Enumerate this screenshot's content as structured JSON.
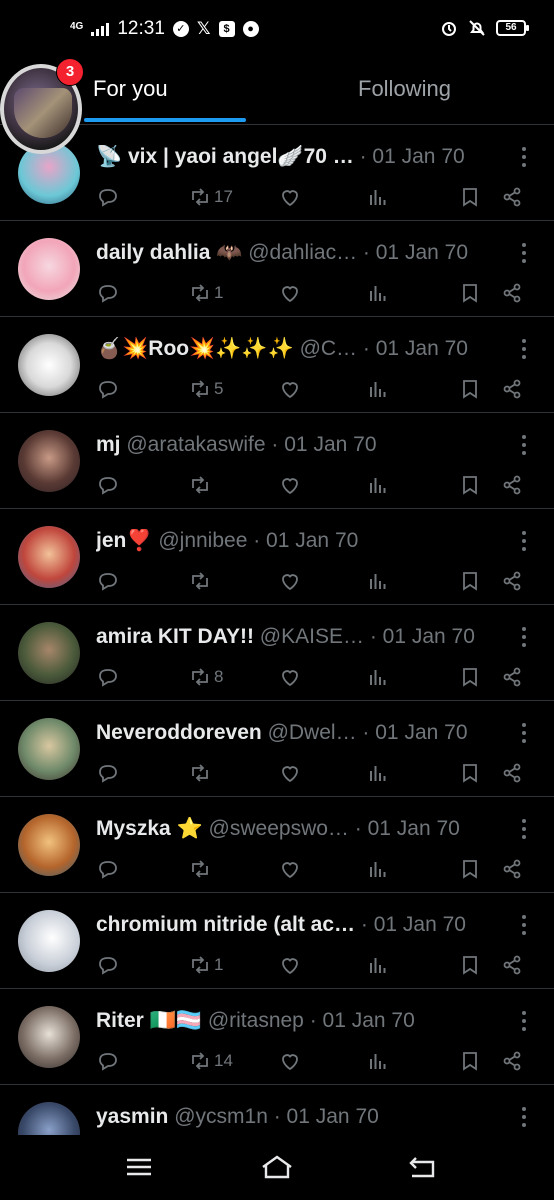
{
  "status_bar": {
    "network": "4G",
    "time": "12:31",
    "battery": "56"
  },
  "top_nav": {
    "badge_count": "3",
    "tabs": [
      {
        "label": "For you",
        "active": true
      },
      {
        "label": "Following",
        "active": false
      }
    ]
  },
  "posts": [
    {
      "name": "📡 vix | yaoi angel🪽70 …",
      "handle": "",
      "date": "· 01 Jan 70",
      "reposts": "17"
    },
    {
      "name": "daily dahlia 🦇",
      "handle": "@dahliac…",
      "date": "· 01 Jan 70",
      "reposts": "1"
    },
    {
      "name": "🧉💥Roo💥✨✨✨",
      "handle": "@C…",
      "date": "· 01 Jan 70",
      "reposts": "5"
    },
    {
      "name": "mj",
      "handle": "@aratakaswife",
      "date": "· 01 Jan 70",
      "reposts": ""
    },
    {
      "name": "jen❣️",
      "handle": "@jnnibee",
      "date": "· 01 Jan 70",
      "reposts": ""
    },
    {
      "name": "amira KIT DAY!!",
      "handle": "@KAISE…",
      "date": "· 01 Jan 70",
      "reposts": "8"
    },
    {
      "name": "Neveroddoreven",
      "handle": "@Dwel…",
      "date": "· 01 Jan 70",
      "reposts": ""
    },
    {
      "name": "Myszka ⭐",
      "handle": "@sweepswo…",
      "date": "· 01 Jan 70",
      "reposts": ""
    },
    {
      "name": "chromium nitride (alt ac…",
      "handle": "",
      "date": "· 01 Jan 70",
      "reposts": "1"
    },
    {
      "name": "Riter 🇮🇪🏳️‍⚧️",
      "handle": "@ritasnep",
      "date": "· 01 Jan 70",
      "reposts": "14"
    },
    {
      "name": "yasmin",
      "handle": "@ycsm1n",
      "date": "· 01 Jan 70",
      "reposts": ""
    }
  ],
  "colors": {
    "accent": "#1d9bf0",
    "badge": "#f4212e",
    "muted": "#71767b",
    "divider": "#2f3336"
  },
  "icons": {
    "top_nav": [
      "avatar"
    ],
    "post_actions": [
      "reply-icon",
      "repost-icon",
      "like-icon",
      "views-icon",
      "bookmark-icon",
      "share-icon"
    ],
    "bottom_nav": [
      "menu-icon",
      "home-icon",
      "back-icon"
    ]
  }
}
